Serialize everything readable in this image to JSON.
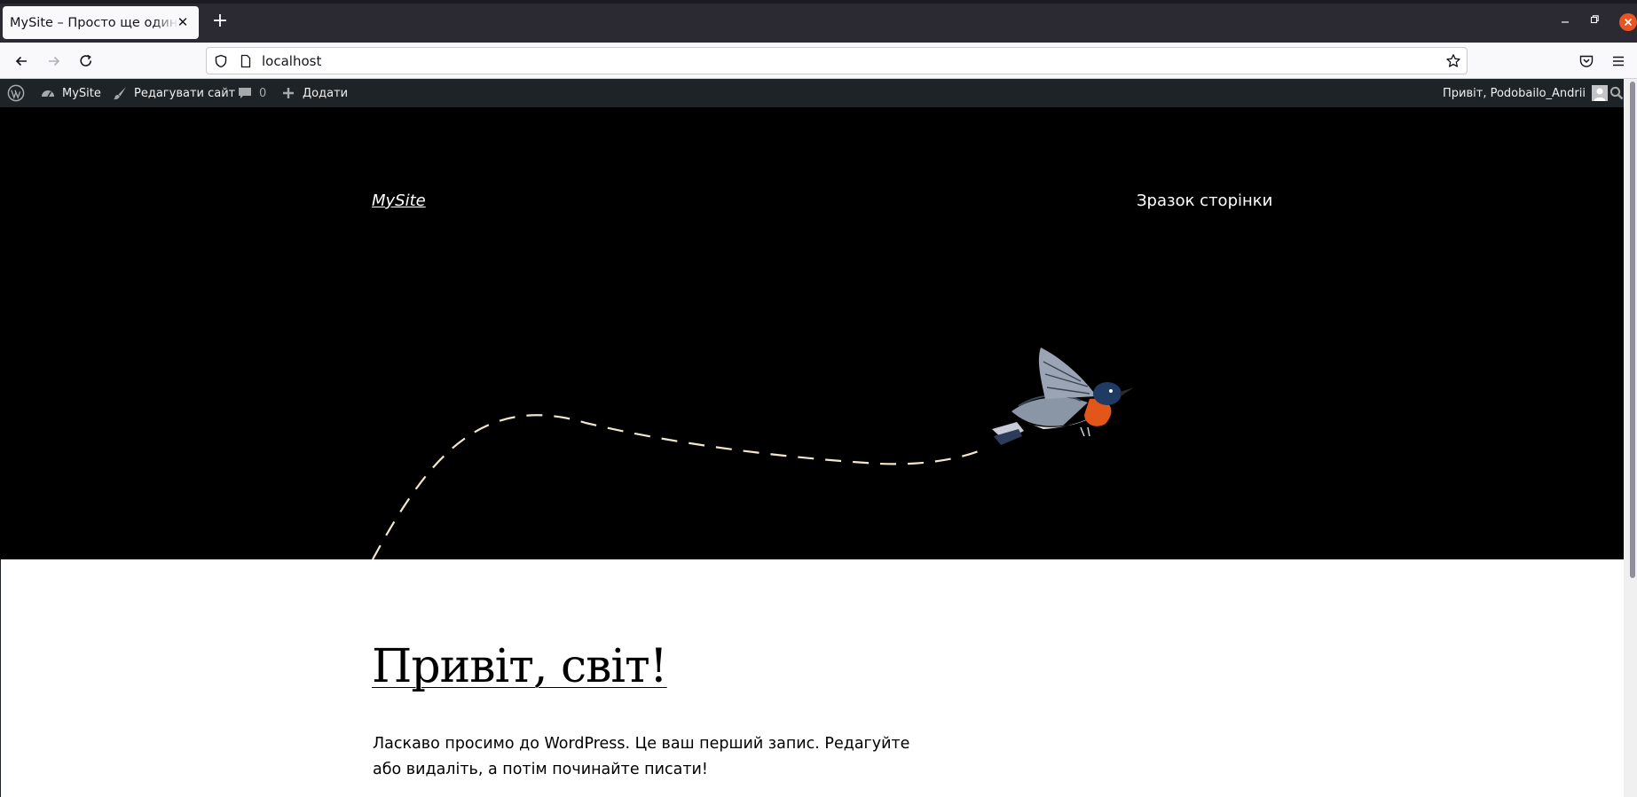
{
  "browser": {
    "tab_title": "MySite – Просто ще один сайт",
    "tab_close": "✕",
    "new_tab": "+",
    "url": "localhost"
  },
  "adminbar": {
    "site_name": "MySite",
    "edit_site": "Редагувати сайт",
    "comments_count": "0",
    "add_new": "Додати",
    "greeting": "Привіт, Podobailo_Andrii"
  },
  "site": {
    "title": "MySite",
    "nav_link": "Зразок сторінки"
  },
  "post": {
    "title": "Привіт, світ!",
    "body": "Ласкаво просимо до WordPress. Це ваш перший запис. Редагуйте або видаліть, а потім починайте писати!"
  },
  "colors": {
    "adminbar_bg": "#1d2327",
    "hero_bg": "#000000",
    "close_button": "#e95420",
    "bird_breast": "#e2561a",
    "bird_head": "#1f3a63"
  }
}
